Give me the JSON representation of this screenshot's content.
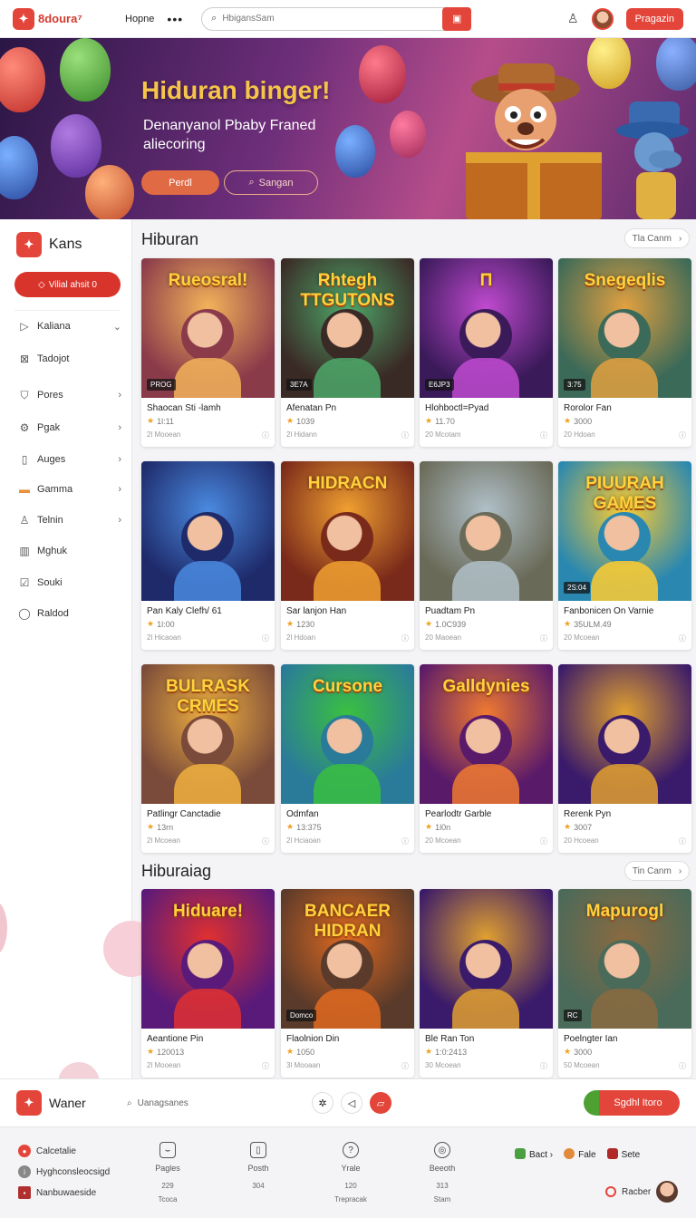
{
  "header": {
    "logo_text": "8doura⁷",
    "nav_link": "Hopne",
    "search_placeholder": "HbigansSam",
    "register_label": "Pragazin"
  },
  "hero": {
    "title": "Hiduran binger!",
    "subtitle": "Denanyanol Pbaby Franed aliecoring",
    "primary_label": "Perdl",
    "secondary_label": "Sangan"
  },
  "sidebar": {
    "brand": "Kans",
    "cta_label": "Vilial ahsit 0",
    "items": [
      {
        "label": "Kaliana",
        "icon": "play-icon",
        "chevron": "⌄"
      },
      {
        "label": "Tadojot",
        "icon": "grid-icon",
        "chevron": ""
      },
      {
        "label": "Pores",
        "icon": "shield-icon",
        "chevron": "›"
      },
      {
        "label": "Pgak",
        "icon": "gear-icon",
        "chevron": "›"
      },
      {
        "label": "Auges",
        "icon": "document-icon",
        "chevron": "›"
      },
      {
        "label": "Gamma",
        "icon": "folder-icon",
        "chevron": "›"
      },
      {
        "label": "Telnin",
        "icon": "user-icon",
        "chevron": "›"
      },
      {
        "label": "Mghuk",
        "icon": "building-icon",
        "chevron": ""
      },
      {
        "label": "Souki",
        "icon": "check-icon",
        "chevron": ""
      },
      {
        "label": "Raldod",
        "icon": "location-icon",
        "chevron": ""
      }
    ]
  },
  "sections": [
    {
      "title": "Hiburan",
      "more_label": "Tla Canm",
      "cards": [
        {
          "name": "Shaocan Sti -lamh",
          "rating": "1l:11",
          "players": "2l Mooean",
          "badge": "PROG",
          "thumb_title": "Rueosral!",
          "bg": "#8a3b4a",
          "accent": "#f2b35a"
        },
        {
          "name": "Afenatan Pn",
          "rating": "1039",
          "players": "2l Hidann",
          "badge": "3E7A",
          "thumb_title": "Rhtegh TTGUTONS",
          "bg": "#3a2a26",
          "accent": "#4ea86a"
        },
        {
          "name": "Hlohboctl=Pyad",
          "rating": "11.70",
          "players": "20 Mcotam",
          "badge": "E6JP3",
          "thumb_title": "Π",
          "bg": "#3b1a5a",
          "accent": "#c04ad0"
        },
        {
          "name": "Rorolor Fan",
          "rating": "3000",
          "players": "20 Hdoan",
          "badge": "3:75",
          "thumb_title": "Snegeqlis",
          "bg": "#3c6a58",
          "accent": "#e2a040"
        }
      ]
    },
    {
      "title": "",
      "more_label": "",
      "cards": [
        {
          "name": "Pan Kaly Clefh/ 61",
          "rating": "1l:00",
          "players": "2l Hicaoan",
          "badge": "",
          "thumb_title": "",
          "bg": "#1e2a6a",
          "accent": "#4a8ae0"
        },
        {
          "name": "Sar lanjon Han",
          "rating": "1230",
          "players": "2l Hdoan",
          "badge": "",
          "thumb_title": "HIDRACN",
          "bg": "#7a2a1a",
          "accent": "#f0a030"
        },
        {
          "name": "Puadtam Pn",
          "rating": "1.0C939",
          "players": "20 Maoean",
          "badge": "",
          "thumb_title": "",
          "bg": "#6a6a58",
          "accent": "#b0c0c8"
        },
        {
          "name": "Fanbonicen On Varnie",
          "rating": "35ULM.49",
          "players": "20 Mcoean",
          "badge": "2S:04",
          "thumb_title": "PIUURAH GAMES",
          "bg": "#2a88b0",
          "accent": "#ffcc30"
        }
      ]
    },
    {
      "title": "",
      "more_label": "",
      "cards": [
        {
          "name": "Patlingr Canctadie",
          "rating": "13rn",
          "players": "2l Mcoean",
          "badge": "",
          "thumb_title": "BULRASK CRMES",
          "bg": "#7a4a3a",
          "accent": "#f0b040"
        },
        {
          "name": "Odmfan",
          "rating": "13:375",
          "players": "2l Hciaoan",
          "badge": "",
          "thumb_title": "Cursone",
          "bg": "#2a7a9a",
          "accent": "#3ac040"
        },
        {
          "name": "Pearlodtr Garble",
          "rating": "1l0n",
          "players": "20 Mcoean",
          "badge": "",
          "thumb_title": "Galldynies",
          "bg": "#5a1a6a",
          "accent": "#f07a30"
        },
        {
          "name": "Rerenk Pyn",
          "rating": "3007",
          "players": "20 Hcoean",
          "badge": "",
          "thumb_title": "",
          "bg": "#3a1a6a",
          "accent": "#e0a030"
        }
      ]
    },
    {
      "title": "Hiburaiag",
      "more_label": "Tin Canm",
      "cards": [
        {
          "name": "Aeantione Pin",
          "rating": "120013",
          "players": "2l Mooean",
          "badge": "",
          "thumb_title": "Hiduare!",
          "bg": "#5a1a7a",
          "accent": "#e03030"
        },
        {
          "name": "Flaolnion Din",
          "rating": "1050",
          "players": "3l Mooaan",
          "badge": "Domco",
          "thumb_title": "BANCAER HIDRAN",
          "bg": "#5a3a2a",
          "accent": "#e06a20"
        },
        {
          "name": "Ble Ran Ton",
          "rating": "1:0:2413",
          "players": "30 Mcoean",
          "badge": "",
          "thumb_title": "",
          "bg": "#3a1a6a",
          "accent": "#e0a030"
        },
        {
          "name": "Poelngter Ian",
          "rating": "3000",
          "players": "50 Mcoean",
          "badge": "RC",
          "thumb_title": "Mapurogl",
          "bg": "#4a6a5a",
          "accent": "#8a6a40"
        }
      ]
    }
  ],
  "bottom_bar": {
    "brand": "Waner",
    "search_label": "Uanagsanes",
    "cta_label": "Sgdhl Itoro"
  },
  "footer": {
    "links": [
      "Calcetalie",
      "Hyghconsleocsigd",
      "Nanbuwaeside"
    ],
    "stats": [
      {
        "icon": "chat-icon",
        "label": "Pagles",
        "value": "229",
        "sub": "Tcoca"
      },
      {
        "icon": "phone-icon",
        "label": "Posth",
        "value": "304",
        "sub": ""
      },
      {
        "icon": "info-icon",
        "label": "Yrale",
        "value": "120",
        "sub": "Trepracak"
      },
      {
        "icon": "target-icon",
        "label": "Beeoth",
        "value": "313",
        "sub": "Stam"
      }
    ],
    "right_links": [
      "Bact ›",
      "Fale",
      "Sete"
    ],
    "user_label": "Racber"
  },
  "colors": {
    "accent": "#e4453a",
    "hero_title": "#f5c54a"
  }
}
